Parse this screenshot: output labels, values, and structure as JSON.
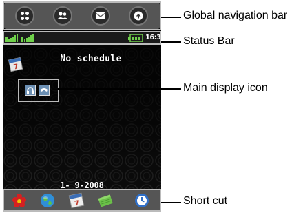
{
  "screen": {
    "schedule_text": "No schedule",
    "status_time": "16:37",
    "date_text": "1- 9-2008"
  },
  "gnb_icons": [
    "apps-icon",
    "contacts-icon",
    "message-icon",
    "connect-icon"
  ],
  "shortcut_icons": [
    "flower-icon",
    "globe-icon",
    "calendar-icon",
    "notes-icon",
    "clock-icon"
  ],
  "callouts": {
    "global_nav": "Global navigation bar",
    "status_bar": "Status Bar",
    "main_display": "Main display icon",
    "short_cut": "Short cut"
  }
}
